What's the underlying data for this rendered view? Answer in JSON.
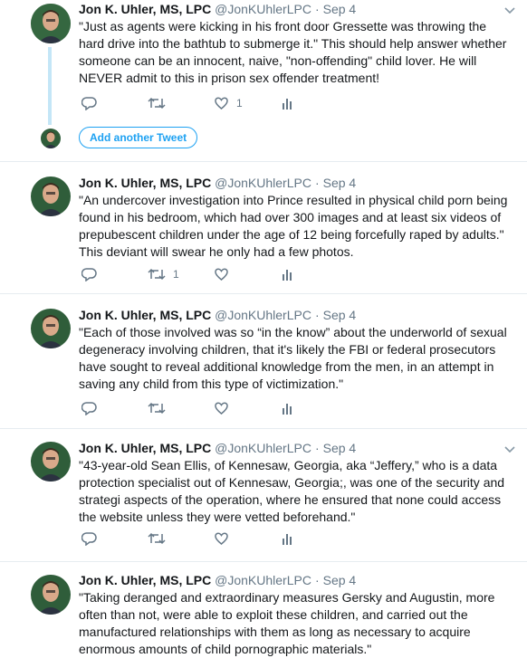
{
  "tweets": [
    {
      "name": "Jon K. Uhler, MS, LPC",
      "handle": "@JonKUhlerLPC",
      "time": "Sep 4",
      "text": "\"Just as agents were kicking in his front door Gressette was throwing the hard drive into the bathtub to submerge it.\"  This should help answer whether someone can be an innocent, naive, \"non-offending\" child lover. He will NEVER admit to this in prison sex offender treatment!",
      "reply_count": "",
      "retweet_count": "",
      "like_count": "1"
    },
    {
      "name": "Jon K. Uhler, MS, LPC",
      "handle": "@JonKUhlerLPC",
      "time": "Sep 4",
      "text": "\"An undercover investigation into Prince resulted in physical child porn being found in his bedroom, which had over 300 images and at least six videos of prepubescent children under the age of 12 being forcefully raped by adults.\" This deviant will swear he only had a few photos.",
      "reply_count": "",
      "retweet_count": "1",
      "like_count": ""
    },
    {
      "name": "Jon K. Uhler, MS, LPC",
      "handle": "@JonKUhlerLPC",
      "time": "Sep 4",
      "text": "\"Each of those involved was so “in the know” about the underworld of sexual degeneracy involving children, that it's likely the FBI or federal prosecutors have sought to reveal additional knowledge from the men, in an attempt in saving any child from this type of victimization.\"",
      "reply_count": "",
      "retweet_count": "",
      "like_count": ""
    },
    {
      "name": "Jon K. Uhler, MS, LPC",
      "handle": "@JonKUhlerLPC",
      "time": "Sep 4",
      "text": "\"43-year-old Sean Ellis, of Kennesaw, Georgia, aka “Jeffery,” who is a data protection specialist out of Kennesaw, Georgia;, was one of the security and strategi aspects of the operation, where he ensured that none could access the website unless they were vetted beforehand.\"",
      "reply_count": "",
      "retweet_count": "",
      "like_count": ""
    },
    {
      "name": "Jon K. Uhler, MS, LPC",
      "handle": "@JonKUhlerLPC",
      "time": "Sep 4",
      "text": "\"Taking deranged and extraordinary measures Gersky and Augustin, more often than not, were able to exploit these children, and carried out the manufactured relationships with them as long as necessary to acquire enormous amounts of child pornographic materials.\"",
      "reply_count": "",
      "retweet_count": "",
      "like_count": ""
    }
  ],
  "thread": {
    "add_another_label": "Add another Tweet"
  },
  "icons": {
    "reply": "reply-icon",
    "retweet": "retweet-icon",
    "like": "heart-icon",
    "analytics": "analytics-icon",
    "caret": "chevron-down-icon"
  },
  "colors": {
    "accent": "#1da1f2",
    "muted": "#657786",
    "thread_line": "#c4e6f7",
    "divider": "#e6ecf0"
  }
}
